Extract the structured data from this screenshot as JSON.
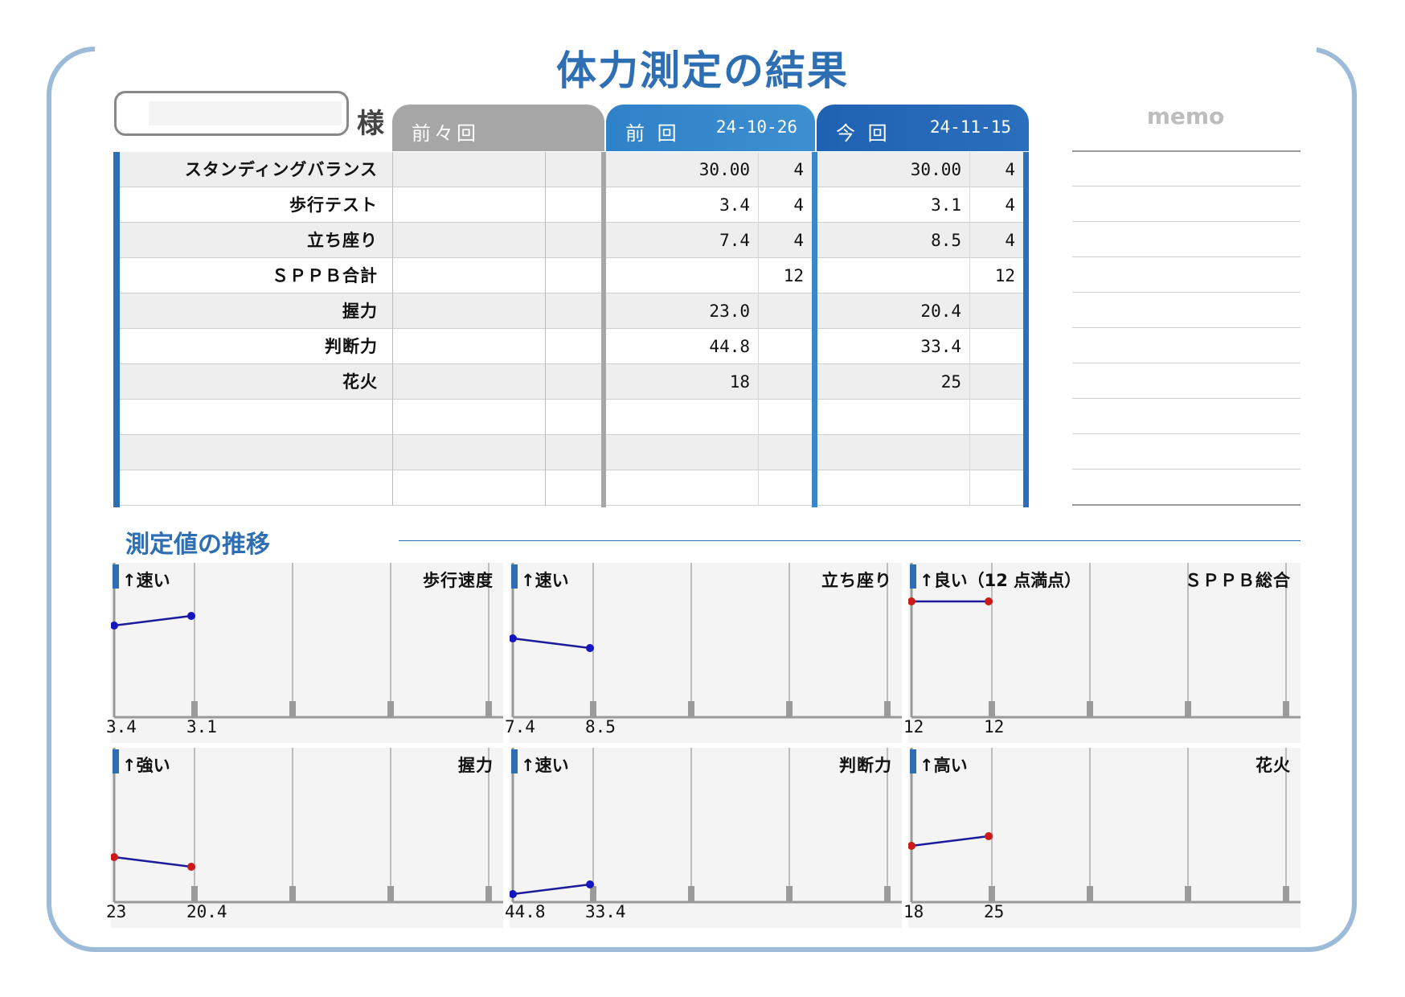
{
  "title": "体力測定の結果",
  "name_suffix": "様",
  "columns": {
    "prev2": {
      "label": "前々回",
      "date": ""
    },
    "prev": {
      "label": "前 回",
      "date": "24-10-26"
    },
    "current": {
      "label": "今 回",
      "date": "24-11-15"
    }
  },
  "rows": [
    {
      "name": "スタンディングバランス",
      "prev2_value": "",
      "prev2_score": "",
      "prev_value": "30.00",
      "prev_score": "4",
      "cur_value": "30.00",
      "cur_score": "4"
    },
    {
      "name": "歩行テスト",
      "prev2_value": "",
      "prev2_score": "",
      "prev_value": "3.4",
      "prev_score": "4",
      "cur_value": "3.1",
      "cur_score": "4"
    },
    {
      "name": "立ち座り",
      "prev2_value": "",
      "prev2_score": "",
      "prev_value": "7.4",
      "prev_score": "4",
      "cur_value": "8.5",
      "cur_score": "4"
    },
    {
      "name": "ＳＰＰＢ合計",
      "prev2_value": "",
      "prev2_score": "",
      "prev_value": "",
      "prev_score": "12",
      "cur_value": "",
      "cur_score": "12"
    },
    {
      "name": "握力",
      "prev2_value": "",
      "prev2_score": "",
      "prev_value": "23.0",
      "prev_score": "",
      "cur_value": "20.4",
      "cur_score": ""
    },
    {
      "name": "判断力",
      "prev2_value": "",
      "prev2_score": "",
      "prev_value": "44.8",
      "prev_score": "",
      "cur_value": "33.4",
      "cur_score": ""
    },
    {
      "name": "花火",
      "prev2_value": "",
      "prev2_score": "",
      "prev_value": "18",
      "prev_score": "",
      "cur_value": "25",
      "cur_score": ""
    },
    {
      "name": "",
      "prev2_value": "",
      "prev2_score": "",
      "prev_value": "",
      "prev_score": "",
      "cur_value": "",
      "cur_score": ""
    },
    {
      "name": "",
      "prev2_value": "",
      "prev2_score": "",
      "prev_value": "",
      "prev_score": "",
      "cur_value": "",
      "cur_score": ""
    },
    {
      "name": "",
      "prev2_value": "",
      "prev2_score": "",
      "prev_value": "",
      "prev_score": "",
      "cur_value": "",
      "cur_score": ""
    }
  ],
  "memo": {
    "title": "memo"
  },
  "section_title": "測定値の推移",
  "colors": {
    "accent": "#2e6fb3",
    "line": "#1a1a9a",
    "point_blue": "#1515c0",
    "point_red": "#cc1a1a",
    "frame": "#9bbbd8"
  },
  "chart_data": [
    {
      "type": "line",
      "title": "歩行速度",
      "direction": "↑速い",
      "x": [
        "3.4",
        "3.1"
      ],
      "values": [
        3.4,
        3.1
      ],
      "inverted": true,
      "point_color": "blue"
    },
    {
      "type": "line",
      "title": "立ち座り",
      "direction": "↑速い",
      "x": [
        "7.4",
        "8.5"
      ],
      "values": [
        7.4,
        8.5
      ],
      "inverted": true,
      "point_color": "blue"
    },
    {
      "type": "line",
      "title": "ＳＰＰＢ総合",
      "direction": "↑良い（12 点満点）",
      "x": [
        "12",
        "12"
      ],
      "values": [
        12,
        12
      ],
      "inverted": false,
      "point_color": "red"
    },
    {
      "type": "line",
      "title": "握力",
      "direction": "↑強い",
      "x": [
        "23",
        "20.4"
      ],
      "values": [
        23,
        20.4
      ],
      "inverted": false,
      "point_color": "red"
    },
    {
      "type": "line",
      "title": "判断力",
      "direction": "↑速い",
      "x": [
        "44.8",
        "33.4"
      ],
      "values": [
        44.8,
        33.4
      ],
      "inverted": true,
      "point_color": "blue"
    },
    {
      "type": "line",
      "title": "花火",
      "direction": "↑高い",
      "x": [
        "18",
        "25"
      ],
      "values": [
        18,
        25
      ],
      "inverted": false,
      "point_color": "red"
    }
  ]
}
